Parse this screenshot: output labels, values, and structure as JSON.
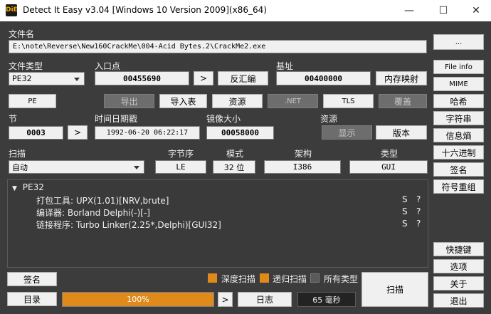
{
  "window": {
    "logo": "DiE",
    "title": "Detect It Easy v3.04 [Windows 10 Version 2009](x86_64)",
    "minimize": "—",
    "maximize": "☐",
    "close": "✕"
  },
  "file": {
    "label": "文件名",
    "path": "E:\\note\\Reverse\\New160CrackMe\\004-Acid Bytes.2\\CrackMe2.exe",
    "browse": "..."
  },
  "type": {
    "label": "文件类型",
    "value": "PE32"
  },
  "entry": {
    "label": "入口点",
    "value": "00455690",
    "go": ">",
    "disasm": "反汇编"
  },
  "base": {
    "label": "基址",
    "value": "00400000",
    "memmap": "内存映射"
  },
  "tools": {
    "pe": "PE",
    "export": "导出",
    "import": "导入表",
    "resources": "资源",
    "net": ".NET",
    "tls": "TLS",
    "overlay": "覆盖"
  },
  "section": {
    "label": "节",
    "value": "0003",
    "go": ">"
  },
  "timestamp": {
    "label": "时间日期戳",
    "value": "1992-06-20 06:22:17"
  },
  "imagesize": {
    "label": "镜像大小",
    "value": "00058000"
  },
  "res": {
    "label": "资源",
    "show": "显示",
    "version": "版本"
  },
  "scan": {
    "label": "扫描",
    "mode_value": "自动",
    "endian_label": "字节序",
    "endian_value": "LE",
    "bits_label": "模式",
    "bits_value": "32 位",
    "arch_label": "架构",
    "arch_value": "I386",
    "ftype_label": "类型",
    "ftype_value": "GUI"
  },
  "results": {
    "root": "PE32",
    "items": [
      {
        "text": "打包工具: UPX(1.01)[NRV,brute]",
        "s": "S",
        "q": "?"
      },
      {
        "text": "编译器: Borland Delphi(-)[-]",
        "s": "S",
        "q": "?"
      },
      {
        "text": "链接程序: Turbo Linker(2.25*,Delphi)[GUI32]",
        "s": "S",
        "q": "?"
      }
    ]
  },
  "right": {
    "file_info": "File info",
    "mime": "MIME",
    "hash": "哈希",
    "strings": "字符串",
    "entropy": "信息熵",
    "hex": "十六进制",
    "signatures": "签名",
    "symbols": "符号重组",
    "shortcuts": "快捷键",
    "options": "选项",
    "about": "关于",
    "exit": "退出"
  },
  "bottom": {
    "signature": "签名",
    "directory": "目录",
    "progress_text": "100%",
    "progress_value": 1.0,
    "go": ">",
    "log": "日志",
    "time": "65 毫秒",
    "scan": "扫描",
    "deep_scan": "深度扫描",
    "recursive_scan": "递归扫描",
    "all_types": "所有类型"
  },
  "colors": {
    "accent": "#e08a1c",
    "background": "#3c3c3c",
    "field": "#f0f0f0"
  }
}
